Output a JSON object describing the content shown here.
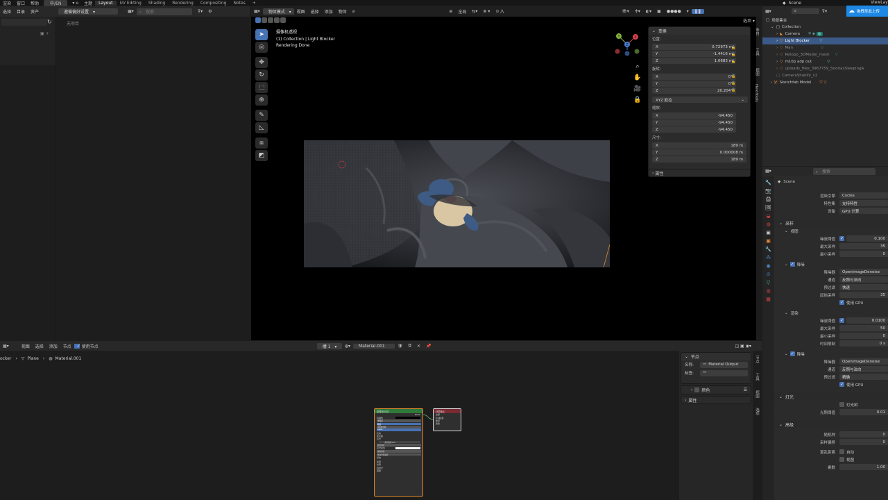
{
  "topbar": {
    "menu": [
      "渲染",
      "窗口",
      "帮助"
    ],
    "lang": "中/EN",
    "home_label": "主题",
    "workspaces": [
      "Layout",
      "UV Editing",
      "Shading",
      "Rendering",
      "Compositing",
      "Notes"
    ],
    "add_workspace": "+",
    "scene_label": "Scene",
    "viewlayer_label": "ViewLay",
    "upload_label": "拖拽至此上传"
  },
  "file_browser": {
    "menus": [
      "选择",
      "目录",
      "资产"
    ],
    "dropdown": "遵循偏好设置",
    "search_placeholder": "搜索",
    "empty_text": "无项目"
  },
  "viewport": {
    "mode": "物体模式",
    "menus": [
      "视图",
      "选择",
      "添加",
      "物体"
    ],
    "global": "全局",
    "options": "选项",
    "overlay_lines": [
      "摄像机透视",
      "(1) Collection | Light Blocker",
      "Rendering Done"
    ],
    "axis_labels": {
      "y": "Y",
      "x": "X",
      "z": "Z"
    }
  },
  "transform": {
    "title": "变换",
    "location_label": "位置:",
    "location": [
      {
        "axis": "X",
        "value": "0.72973 m"
      },
      {
        "axis": "Y",
        "value": "-1.4416 m"
      },
      {
        "axis": "Z",
        "value": "1.0683 m"
      }
    ],
    "rotation_label": "旋转:",
    "rotation": [
      {
        "axis": "X",
        "value": "0°"
      },
      {
        "axis": "Y",
        "value": "0°"
      },
      {
        "axis": "Z",
        "value": "20.204°"
      }
    ],
    "rotation_mode": "XYZ 欧拉",
    "scale_label": "缩放:",
    "scale": [
      {
        "axis": "X",
        "value": "-94.450"
      },
      {
        "axis": "Y",
        "value": "-94.450"
      },
      {
        "axis": "Z",
        "value": "-94.450"
      }
    ],
    "dimensions_label": "尺寸:",
    "dimensions": [
      {
        "axis": "X",
        "value": "189 m"
      },
      {
        "axis": "Y",
        "value": "0.000008 m"
      },
      {
        "axis": "Z",
        "value": "189 m"
      }
    ],
    "properties_label": "属性"
  },
  "viewport_tabs": [
    "条目",
    "工具",
    "视图",
    "HeloTools"
  ],
  "outliner": {
    "search_placeholder": "",
    "root": "场景集合",
    "items": [
      {
        "name": "Collection",
        "depth": 1,
        "selected": false
      },
      {
        "name": "Camera",
        "depth": 2,
        "selected": false
      },
      {
        "name": "Light Blocker",
        "depth": 2,
        "selected": true
      },
      {
        "name": "Man",
        "depth": 2,
        "selected": false
      },
      {
        "name": "Retopo_3DModel_mesh",
        "depth": 2,
        "selected": false
      },
      {
        "name": "m10p adp out",
        "depth": 2,
        "selected": false
      },
      {
        "name": "uploads_files_3967759_SnorlaxSleepingA",
        "depth": 2,
        "selected": false
      },
      {
        "name": "CameraShakify_v2",
        "depth": 1,
        "selected": false
      },
      {
        "name": "Sketchfab Model",
        "depth": 1,
        "selected": false
      }
    ]
  },
  "properties": {
    "search_placeholder": "搜索",
    "scene_name": "Scene",
    "render_engine_label": "渲染引擎",
    "render_engine": "Cycles",
    "feature_set_label": "特性集",
    "feature_set": "支持特性",
    "device_label": "设备",
    "device": "GPU 计算",
    "sampling_label": "采样",
    "viewport_label": "视图",
    "v_noise_label": "噪波阈值",
    "v_noise": "0.100",
    "v_max_label": "最大采样",
    "v_max": "35",
    "v_min_label": "最小采样",
    "v_min": "0",
    "v_denoise_label": "降噪",
    "v_denoiser_label": "降噪器",
    "v_denoiser": "OpenImageDenoise",
    "v_passes_label": "通道",
    "v_passes": "反照与法向",
    "v_prefilter_label": "预过滤",
    "v_prefilter": "快速",
    "v_start_label": "起始采样",
    "v_start": "35",
    "use_gpu_label": "使用 GPU",
    "render_label": "渲染",
    "r_noise_label": "噪波阈值",
    "r_noise": "0.0100",
    "r_max_label": "最大采样",
    "r_max": "50",
    "r_min_label": "最小采样",
    "r_min": "0",
    "r_time_label": "时间限制",
    "r_time": "0 s",
    "r_denoise_label": "降噪",
    "r_denoiser_label": "降噪器",
    "r_denoiser": "OpenImageDenoise",
    "r_passes_label": "通道",
    "r_passes": "反照与法向",
    "r_prefilter_label": "预过滤",
    "r_prefilter": "精确",
    "r_use_gpu_label": "使用 GPU",
    "lights_label": "灯光",
    "light_tree_label": "灯光树",
    "light_threshold_label": "光照阈值",
    "light_threshold": "0.01",
    "advanced_label": "高级",
    "seed_label": "随机种",
    "seed": "0",
    "sample_offset_label": "采样偏移",
    "sample_offset": "0",
    "scrambling_label": "置乱距离",
    "auto_label": "自动",
    "viewport_cb_label": "视图",
    "multiplier_label": "乘数",
    "multiplier": "1.00"
  },
  "node_editor": {
    "menus": [
      "视图",
      "选择",
      "添加",
      "节点"
    ],
    "use_nodes_label": "使用节点",
    "slot": "槽 1",
    "material": "Material.001",
    "breadcrumb": [
      "ocker",
      "Plane",
      "Material.001"
    ],
    "panel_title": "节点",
    "name_label": "名称:",
    "name_value": "Material Output",
    "label_label": "标签:",
    "color_label": "颜色",
    "properties_label": "属性",
    "tabs": [
      "节点",
      "工具",
      "视图",
      "选项"
    ],
    "bsdf_title": "原理化BSDF",
    "bsdf_rows": [
      "BSDF",
      "基础色",
      "金属度",
      "糙度",
      "IOR折射率",
      "Alpha",
      "法向",
      "次表面",
      "高光",
      "多重散射GGX",
      "高光IOR",
      "高光染色",
      "各向异性",
      "各向异性旋转",
      "切向",
      "涂层",
      "光泽",
      "自发光",
      "薄膜"
    ],
    "output_title": "材质输出",
    "output_rows": [
      "全部",
      "表(曲)面",
      "体积",
      "置换"
    ]
  }
}
